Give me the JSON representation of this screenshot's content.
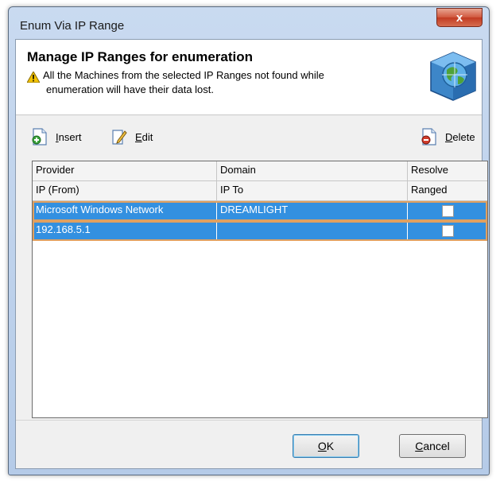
{
  "window": {
    "title": "Enum Via IP Range",
    "close_glyph": "x"
  },
  "header": {
    "title": "Manage IP Ranges for enumeration",
    "warning_line1": "All the Machines from the selected IP Ranges not found while",
    "warning_line2": "enumeration will have their data lost.",
    "warning_icon": "warning-icon",
    "graphic_icon": "globe-icon"
  },
  "toolbar": {
    "insert": {
      "accel": "I",
      "rest": "nsert"
    },
    "edit": {
      "accel": "E",
      "rest": "dit"
    },
    "delete": {
      "accel": "D",
      "rest": "elete"
    }
  },
  "grid": {
    "header_row1": [
      "Provider",
      "Domain",
      "Resolve"
    ],
    "header_row2": [
      "IP (From)",
      "IP To",
      "Ranged"
    ],
    "rows": [
      {
        "col1": "Microsoft Windows Network",
        "col2": "DREAMLIGHT",
        "checked": false
      },
      {
        "col1": "192.168.5.1",
        "col2": "",
        "checked": false
      }
    ]
  },
  "buttons": {
    "ok": {
      "accel": "O",
      "rest": "K"
    },
    "cancel": {
      "accel": "C",
      "rest": "ancel"
    }
  },
  "colors": {
    "selection": "#3390e0",
    "focus_outline": "#e0a060",
    "close_red": "#c13b22"
  }
}
